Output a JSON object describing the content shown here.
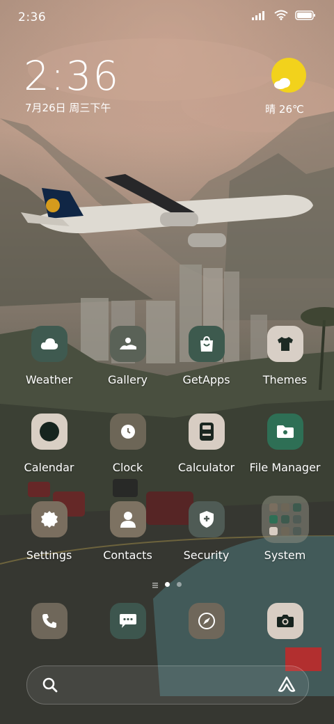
{
  "status_bar": {
    "time": "2:36"
  },
  "clock_widget": {
    "time": "2:36",
    "date": "7月26日 周三下午"
  },
  "weather_widget": {
    "condition_temp": "晴 26℃",
    "icon": "sunny-cloud-icon"
  },
  "apps": [
    {
      "label": "Weather",
      "icon": "cloud-icon",
      "color": "#3f5a50"
    },
    {
      "label": "Gallery",
      "icon": "gallery-icon",
      "color": "#5a6257"
    },
    {
      "label": "GetApps",
      "icon": "shopping-bag-icon",
      "color": "#3d5a4e"
    },
    {
      "label": "Themes",
      "icon": "tshirt-icon",
      "color": "#d8cfc6"
    },
    {
      "label": "Calendar",
      "icon": "calendar-icon",
      "color": "#d9cfc4"
    },
    {
      "label": "Clock",
      "icon": "clock-icon",
      "color": "#6d6657"
    },
    {
      "label": "Calculator",
      "icon": "calculator-icon",
      "color": "#d8cdc3"
    },
    {
      "label": "File Manager",
      "icon": "folder-icon",
      "color": "#2e6f55"
    },
    {
      "label": "Settings",
      "icon": "gear-icon",
      "color": "#7a6e5f"
    },
    {
      "label": "Contacts",
      "icon": "person-icon",
      "color": "#7d7262"
    },
    {
      "label": "Security",
      "icon": "shield-icon",
      "color": "#4f5b55"
    },
    {
      "label": "System",
      "icon": "folder-grid-icon",
      "color": "#8a8a7f"
    }
  ],
  "dock": [
    {
      "icon": "phone-icon",
      "color": "#6f675a"
    },
    {
      "icon": "messages-icon",
      "color": "#3d564e"
    },
    {
      "icon": "browser-compass-icon",
      "color": "#6f675a"
    },
    {
      "icon": "camera-icon",
      "color": "#d8cdc3"
    }
  ],
  "search_bar": {
    "left_icon": "search-icon",
    "right_icon": "assistant-icon"
  }
}
